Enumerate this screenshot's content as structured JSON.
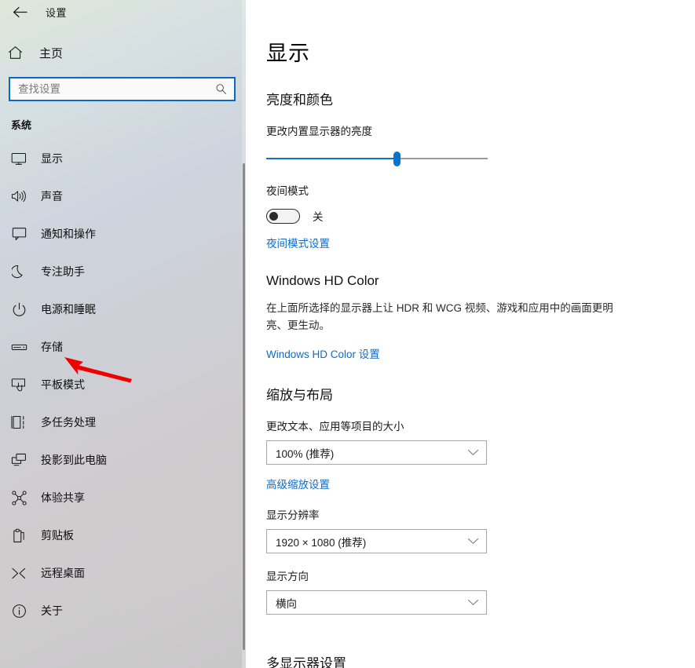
{
  "window": {
    "app_title": "设置",
    "back_icon": "back-arrow-icon"
  },
  "sidebar": {
    "home_label": "主页",
    "home_icon": "home-icon",
    "search": {
      "placeholder": "查找设置",
      "value": "",
      "icon": "search-icon"
    },
    "section_label": "系统",
    "items": [
      {
        "label": "显示",
        "icon": "monitor-icon"
      },
      {
        "label": "声音",
        "icon": "speaker-icon"
      },
      {
        "label": "通知和操作",
        "icon": "notification-icon"
      },
      {
        "label": "专注助手",
        "icon": "moon-icon"
      },
      {
        "label": "电源和睡眠",
        "icon": "power-icon"
      },
      {
        "label": "存储",
        "icon": "storage-icon"
      },
      {
        "label": "平板模式",
        "icon": "tablet-icon"
      },
      {
        "label": "多任务处理",
        "icon": "multitask-icon"
      },
      {
        "label": "投影到此电脑",
        "icon": "project-icon"
      },
      {
        "label": "体验共享",
        "icon": "share-icon"
      },
      {
        "label": "剪贴板",
        "icon": "clipboard-icon"
      },
      {
        "label": "远程桌面",
        "icon": "remote-desktop-icon"
      },
      {
        "label": "关于",
        "icon": "info-icon"
      }
    ]
  },
  "main": {
    "page_title": "显示",
    "brightness_section": {
      "heading": "亮度和颜色",
      "slider_label": "更改内置显示器的亮度",
      "slider_percent": 60,
      "night_mode_label": "夜间模式",
      "night_mode_state": "关",
      "night_mode_link": "夜间模式设置"
    },
    "hd_color_section": {
      "heading": "Windows HD Color",
      "description": "在上面所选择的显示器上让 HDR 和 WCG 视频、游戏和应用中的画面更明亮、更生动。",
      "link": "Windows HD Color 设置"
    },
    "scale_section": {
      "heading": "缩放与布局",
      "scale_label": "更改文本、应用等项目的大小",
      "scale_value": "100% (推荐)",
      "advanced_link": "高级缩放设置",
      "resolution_label": "显示分辨率",
      "resolution_value": "1920 × 1080 (推荐)",
      "orientation_label": "显示方向",
      "orientation_value": "横向"
    },
    "multi_display_heading": "多显示器设置"
  },
  "annotation": {
    "arrow_icon": "red-arrow-pointer",
    "arrow_color": "#ee0000",
    "points_at": "存储"
  },
  "colors": {
    "accent_blue": "#0a72d1",
    "link_blue": "#0a6ccc",
    "search_border": "#0b68c6",
    "main_bg": "#ffffff",
    "arrow_red": "#ee0000"
  }
}
